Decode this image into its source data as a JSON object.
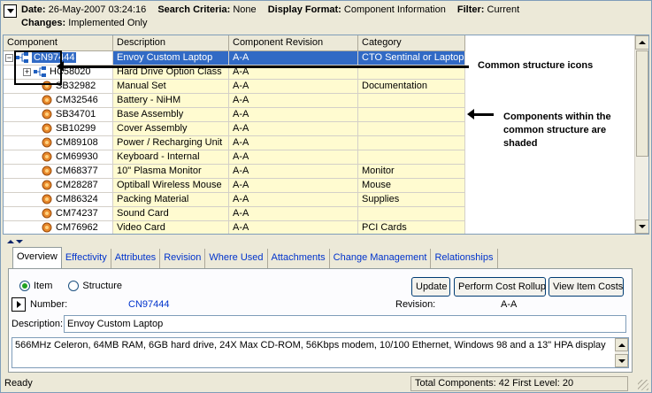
{
  "header": {
    "date_label": "Date:",
    "date_value": "26-May-2007 03:24:16",
    "criteria_label": "Search Criteria:",
    "criteria_value": "None",
    "format_label": "Display Format:",
    "format_value": "Component Information",
    "filter_label": "Filter:",
    "filter_value": "Current",
    "changes_label": "Changes:",
    "changes_value": "Implemented Only"
  },
  "grid": {
    "columns": [
      "Component",
      "Description",
      "Component Revision",
      "Category"
    ],
    "rows": [
      {
        "component": "CN97444",
        "description": "Envoy Custom Laptop",
        "revision": "A-A",
        "category": "CTO Sentinal or Laptop"
      },
      {
        "component": "HC58020",
        "description": "Hard Drive Option Class",
        "revision": "A-A",
        "category": ""
      },
      {
        "component": "SB32982",
        "description": "Manual Set",
        "revision": "A-A",
        "category": "Documentation"
      },
      {
        "component": "CM32546",
        "description": "Battery - NiHM",
        "revision": "A-A",
        "category": ""
      },
      {
        "component": "SB34701",
        "description": "Base Assembly",
        "revision": "A-A",
        "category": ""
      },
      {
        "component": "SB10299",
        "description": "Cover Assembly",
        "revision": "A-A",
        "category": ""
      },
      {
        "component": "CM89108",
        "description": "Power / Recharging Unit",
        "revision": "A-A",
        "category": ""
      },
      {
        "component": "CM69930",
        "description": "Keyboard - Internal",
        "revision": "A-A",
        "category": ""
      },
      {
        "component": "CM68377",
        "description": "10\" Plasma Monitor",
        "revision": "A-A",
        "category": "Monitor"
      },
      {
        "component": "CM28287",
        "description": "Optiball Wireless Mouse",
        "revision": "A-A",
        "category": "Mouse"
      },
      {
        "component": "CM86324",
        "description": "Packing Material",
        "revision": "A-A",
        "category": "Supplies"
      },
      {
        "component": "CM74237",
        "description": "Sound Card",
        "revision": "A-A",
        "category": ""
      },
      {
        "component": "CM76962",
        "description": "Video Card",
        "revision": "A-A",
        "category": "PCI Cards"
      }
    ]
  },
  "annotations": {
    "icons_note": "Common structure icons",
    "shaded_note": "Components within the common structure are shaded"
  },
  "tabs": [
    "Overview",
    "Effectivity",
    "Attributes",
    "Revision",
    "Where Used",
    "Attachments",
    "Change Management",
    "Relationships"
  ],
  "overview": {
    "item_label": "Item",
    "structure_label": "Structure",
    "update_button": "Update",
    "cost_rollup_button": "Perform Cost Rollup",
    "view_costs_button": "View Item Costs",
    "number_label": "Number:",
    "number_value": "CN97444",
    "revision_label": "Revision:",
    "revision_value": "A-A",
    "description_label": "Description:",
    "description_value": "Envoy Custom Laptop",
    "long_description": "566MHz Celeron, 64MB RAM, 6GB hard drive, 24X Max CD-ROM, 56Kbps modem, 10/100 Ethernet, Windows 98 and a 13\" HPA display"
  },
  "status": {
    "ready": "Ready",
    "totals": "Total Components: 42  First Level: 20"
  }
}
